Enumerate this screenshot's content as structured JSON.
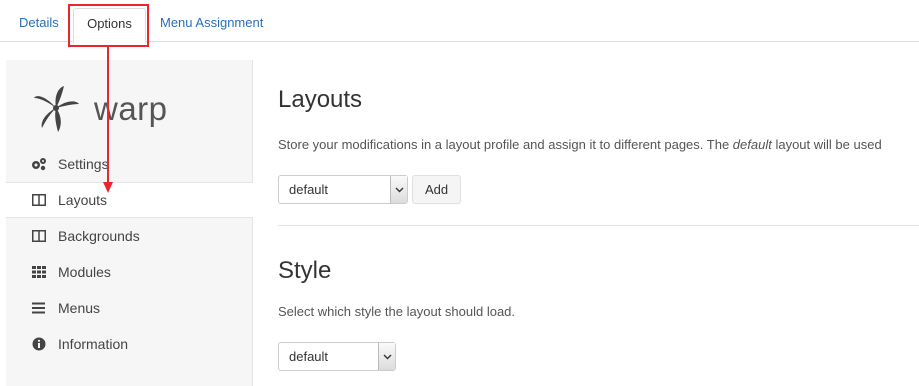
{
  "tabs": {
    "details": "Details",
    "options": "Options",
    "menu_assignment": "Menu Assignment"
  },
  "logo": {
    "text": "warp",
    "icon": "warp-leaf-icon"
  },
  "sidebar": {
    "items": [
      {
        "label": "Settings",
        "icon": "gears-icon"
      },
      {
        "label": "Layouts",
        "icon": "columns-icon",
        "active": true
      },
      {
        "label": "Backgrounds",
        "icon": "columns-icon"
      },
      {
        "label": "Modules",
        "icon": "grid-icon"
      },
      {
        "label": "Menus",
        "icon": "bars-icon"
      },
      {
        "label": "Information",
        "icon": "info-circle-icon"
      }
    ]
  },
  "layouts": {
    "title": "Layouts",
    "desc_before": "Store your modifications in a layout profile and assign it to different pages. The ",
    "desc_em": "default",
    "desc_after": " layout will be used",
    "select_value": "default",
    "add_label": "Add"
  },
  "style": {
    "title": "Style",
    "desc": "Select which style the layout should load.",
    "select_value": "default"
  },
  "colors": {
    "annotation": "#e8262b",
    "link": "#2a6ebb"
  }
}
